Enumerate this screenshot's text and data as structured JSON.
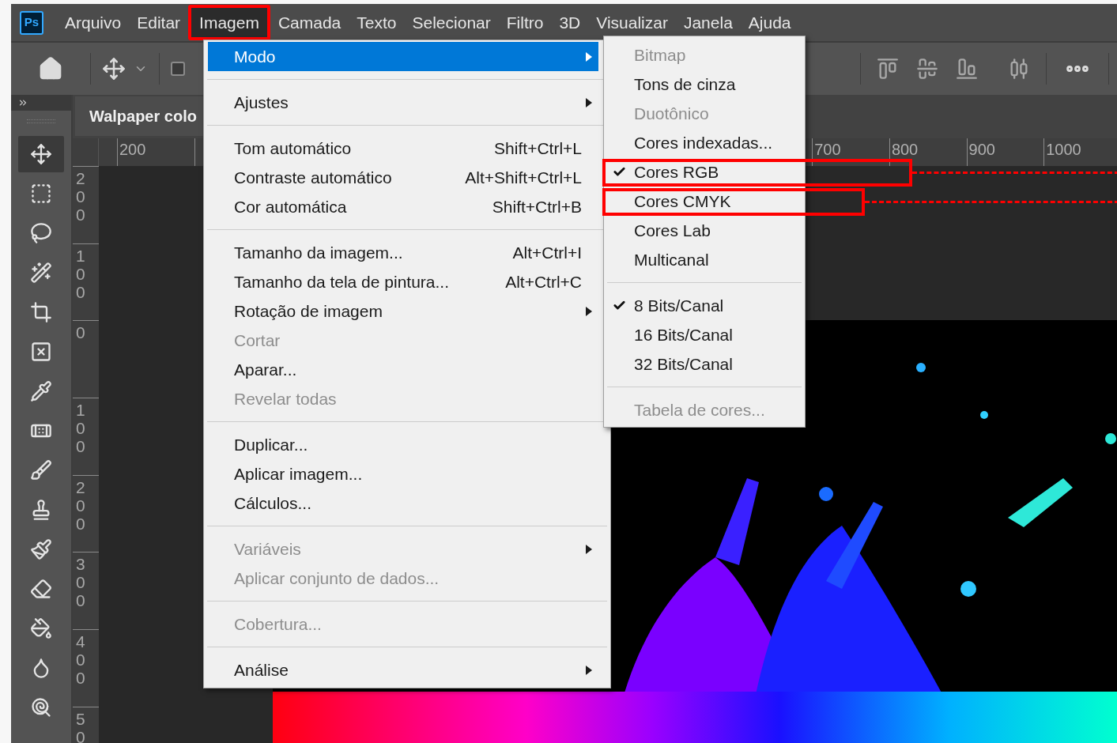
{
  "logo": "Ps",
  "menubar": {
    "items": [
      {
        "label": "Arquivo",
        "selected": false,
        "highlighted": false
      },
      {
        "label": "Editar",
        "selected": false,
        "highlighted": false
      },
      {
        "label": "Imagem",
        "selected": true,
        "highlighted": true
      },
      {
        "label": "Camada",
        "selected": false,
        "highlighted": false
      },
      {
        "label": "Texto",
        "selected": false,
        "highlighted": false
      },
      {
        "label": "Selecionar",
        "selected": false,
        "highlighted": false
      },
      {
        "label": "Filtro",
        "selected": false,
        "highlighted": false
      },
      {
        "label": "3D",
        "selected": false,
        "highlighted": false
      },
      {
        "label": "Visualizar",
        "selected": false,
        "highlighted": false
      },
      {
        "label": "Janela",
        "selected": false,
        "highlighted": false
      },
      {
        "label": "Ajuda",
        "selected": false,
        "highlighted": false
      }
    ]
  },
  "options_bar": {
    "checkbox": {
      "checked": false
    }
  },
  "tools": [
    {
      "selected": true
    },
    {
      "selected": false
    },
    {
      "selected": false
    },
    {
      "selected": false
    },
    {
      "selected": false
    },
    {
      "selected": false
    },
    {
      "selected": false
    },
    {
      "selected": false
    },
    {
      "selected": false
    },
    {
      "selected": false
    },
    {
      "selected": false
    },
    {
      "selected": false
    },
    {
      "selected": false
    },
    {
      "selected": false
    },
    {
      "selected": false
    }
  ],
  "document_tab": {
    "title": "Walpaper colo"
  },
  "ruler_horizontal": [
    "200",
    "700",
    "800",
    "900",
    "1000"
  ],
  "ruler_vertical": [
    "200",
    "100",
    "0",
    "100",
    "200",
    "300",
    "400",
    "50"
  ],
  "menu": {
    "items": [
      {
        "kind": "item",
        "label": "Modo",
        "submenu": true,
        "selected": true,
        "disabled": false
      },
      {
        "kind": "separator"
      },
      {
        "kind": "item",
        "label": "Ajustes",
        "submenu": true,
        "selected": false,
        "disabled": false
      },
      {
        "kind": "separator"
      },
      {
        "kind": "item",
        "label": "Tom automático",
        "shortcut": "Shift+Ctrl+L",
        "submenu": false,
        "selected": false,
        "disabled": false
      },
      {
        "kind": "item",
        "label": "Contraste automático",
        "shortcut": "Alt+Shift+Ctrl+L",
        "submenu": false,
        "selected": false,
        "disabled": false
      },
      {
        "kind": "item",
        "label": "Cor automática",
        "shortcut": "Shift+Ctrl+B",
        "submenu": false,
        "selected": false,
        "disabled": false
      },
      {
        "kind": "separator"
      },
      {
        "kind": "item",
        "label": "Tamanho da imagem...",
        "shortcut": "Alt+Ctrl+I",
        "submenu": false,
        "selected": false,
        "disabled": false
      },
      {
        "kind": "item",
        "label": "Tamanho da tela de pintura...",
        "shortcut": "Alt+Ctrl+C",
        "submenu": false,
        "selected": false,
        "disabled": false
      },
      {
        "kind": "item",
        "label": "Rotação de imagem",
        "submenu": true,
        "selected": false,
        "disabled": false
      },
      {
        "kind": "item",
        "label": "Cortar",
        "submenu": false,
        "selected": false,
        "disabled": true
      },
      {
        "kind": "item",
        "label": "Aparar...",
        "submenu": false,
        "selected": false,
        "disabled": false
      },
      {
        "kind": "item",
        "label": "Revelar todas",
        "submenu": false,
        "selected": false,
        "disabled": true
      },
      {
        "kind": "separator"
      },
      {
        "kind": "item",
        "label": "Duplicar...",
        "submenu": false,
        "selected": false,
        "disabled": false
      },
      {
        "kind": "item",
        "label": "Aplicar imagem...",
        "submenu": false,
        "selected": false,
        "disabled": false
      },
      {
        "kind": "item",
        "label": "Cálculos...",
        "submenu": false,
        "selected": false,
        "disabled": false
      },
      {
        "kind": "separator"
      },
      {
        "kind": "item",
        "label": "Variáveis",
        "submenu": true,
        "selected": false,
        "disabled": true
      },
      {
        "kind": "item",
        "label": "Aplicar conjunto de dados...",
        "submenu": false,
        "selected": false,
        "disabled": true
      },
      {
        "kind": "separator"
      },
      {
        "kind": "item",
        "label": "Cobertura...",
        "submenu": false,
        "selected": false,
        "disabled": true
      },
      {
        "kind": "separator"
      },
      {
        "kind": "item",
        "label": "Análise",
        "submenu": true,
        "selected": false,
        "disabled": false
      }
    ]
  },
  "submenu": {
    "items": [
      {
        "kind": "item",
        "label": "Bitmap",
        "checked": false,
        "disabled": true,
        "highlighted": false
      },
      {
        "kind": "item",
        "label": "Tons de cinza",
        "checked": false,
        "disabled": false,
        "highlighted": false
      },
      {
        "kind": "item",
        "label": "Duotônico",
        "checked": false,
        "disabled": true,
        "highlighted": false
      },
      {
        "kind": "item",
        "label": "Cores indexadas...",
        "checked": false,
        "disabled": false,
        "highlighted": false
      },
      {
        "kind": "item",
        "label": "Cores RGB",
        "checked": true,
        "disabled": false,
        "highlighted": true
      },
      {
        "kind": "item",
        "label": "Cores CMYK",
        "checked": false,
        "disabled": false,
        "highlighted": true
      },
      {
        "kind": "item",
        "label": "Cores Lab",
        "checked": false,
        "disabled": false,
        "highlighted": false
      },
      {
        "kind": "item",
        "label": "Multicanal",
        "checked": false,
        "disabled": false,
        "highlighted": false
      },
      {
        "kind": "separator"
      },
      {
        "kind": "item",
        "label": "8 Bits/Canal",
        "checked": true,
        "disabled": false,
        "highlighted": false
      },
      {
        "kind": "item",
        "label": "16 Bits/Canal",
        "checked": false,
        "disabled": false,
        "highlighted": false
      },
      {
        "kind": "item",
        "label": "32 Bits/Canal",
        "checked": false,
        "disabled": false,
        "highlighted": false
      },
      {
        "kind": "separator"
      },
      {
        "kind": "item",
        "label": "Tabela de cores...",
        "checked": false,
        "disabled": true,
        "highlighted": false
      }
    ]
  }
}
